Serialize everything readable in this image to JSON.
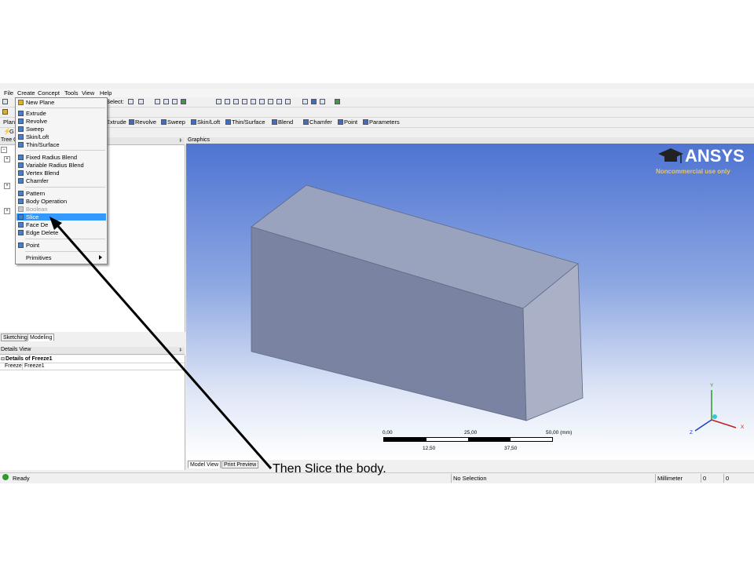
{
  "menubar": {
    "items": [
      "File",
      "Create",
      "Concept",
      "Tools",
      "View",
      "Help"
    ]
  },
  "toolbar1": {
    "select_label": "Select:"
  },
  "toolbar3": {
    "items": [
      "Extrude",
      "Revolve",
      "Sweep",
      "Skin/Loft",
      "Thin/Surface",
      "Blend",
      "Chamfer",
      "Point",
      "Parameters"
    ]
  },
  "tree": {
    "header": "Tree O",
    "left_labels": [
      "Plan",
      "G"
    ]
  },
  "tabs": {
    "sketching": "Sketching",
    "modeling": "Modeling"
  },
  "details": {
    "header": "Details View",
    "title": "Details of Freeze1",
    "row_key": "Freeze",
    "row_value": "Freeze1"
  },
  "graphics": {
    "header": "Graphics",
    "logo_title": "ANSYS",
    "logo_sub": "Noncommercial use only",
    "scale": {
      "top_labels": [
        "0,00",
        "25,00",
        "50,00 (mm)"
      ],
      "bottom_labels": [
        "12,50",
        "37,50"
      ]
    },
    "axes": {
      "x": "X",
      "y": "Y",
      "z": "Z"
    }
  },
  "bottom_tabs": {
    "model_view": "Model View",
    "print_preview": "Print Preview"
  },
  "create_menu": {
    "items": [
      {
        "label": "New Plane"
      },
      {
        "label": "Extrude"
      },
      {
        "label": "Revolve"
      },
      {
        "label": "Sweep"
      },
      {
        "label": "Skin/Loft"
      },
      {
        "label": "Thin/Surface"
      },
      {
        "label": "Fixed Radius Blend"
      },
      {
        "label": "Variable Radius Blend"
      },
      {
        "label": "Vertex Blend"
      },
      {
        "label": "Chamfer"
      },
      {
        "label": "Pattern"
      },
      {
        "label": "Body Operation"
      },
      {
        "label": "Boolean"
      },
      {
        "label": "Slice"
      },
      {
        "label": "Face De"
      },
      {
        "label": "Edge Delete"
      },
      {
        "label": "Point"
      },
      {
        "label": "Primitives"
      }
    ]
  },
  "status": {
    "ready": "Ready",
    "selection": "No Selection",
    "units": "Millimeter",
    "v1": "0",
    "v2": "0"
  },
  "caption": "Then Slice the body.",
  "colors": {
    "accent_highlight": "#3399ff",
    "graphics_top": "#4e74d2",
    "logo_sub": "#e8c46a"
  }
}
